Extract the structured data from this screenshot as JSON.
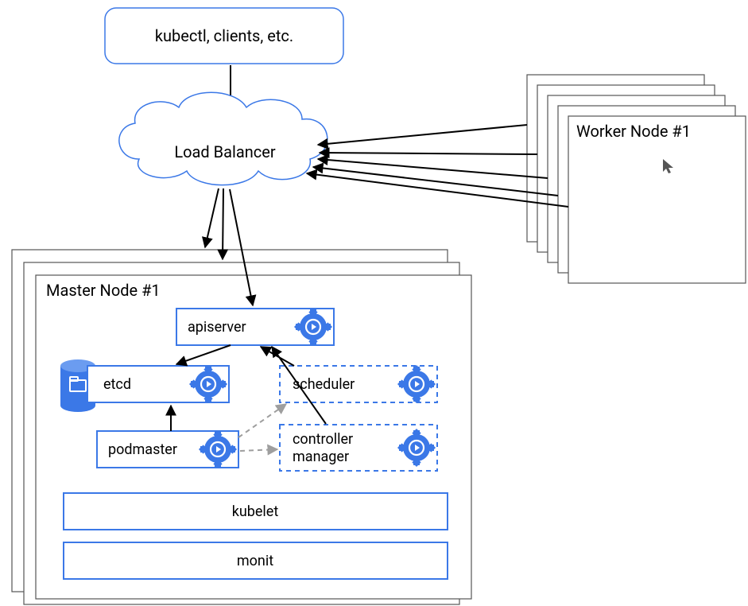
{
  "top_client_box": "kubectl, clients, etc.",
  "load_balancer": "Load Balancer",
  "worker_nodes": {
    "back_4": "Worker Node #1",
    "back_3": "Worker Node #1",
    "back_2": "Worker Node #1",
    "back_1": "Worker Node #1",
    "front": "Worker Node #1"
  },
  "master_nodes": {
    "back_2": "Master Node #1",
    "back_1": "Master Node #1",
    "front": "Master Node #1"
  },
  "components": {
    "apiserver": "apiserver",
    "etcd": "etcd",
    "scheduler": "scheduler",
    "podmaster": "podmaster",
    "controller_manager_l1": "controller",
    "controller_manager_l2": "manager",
    "kubelet": "kubelet",
    "monit": "monit"
  },
  "colors": {
    "blue": "#3b78e7",
    "border_gray": "#555",
    "dash_gray": "#9e9e9e"
  }
}
